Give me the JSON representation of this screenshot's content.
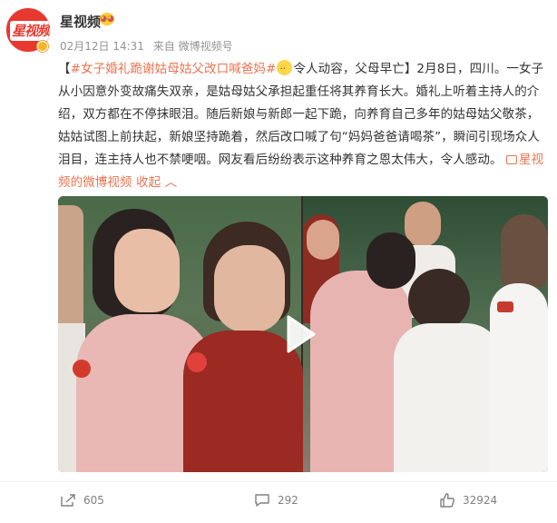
{
  "header": {
    "avatar_text": "星视频",
    "username": "星视频",
    "date": "02月12日 14:31",
    "source": "来自 微博视频号"
  },
  "post": {
    "tag": "#女子婚礼跪谢姑母姑父改口喊爸妈#",
    "text_1": "令人动容，父母早亡】2月8日，四川。一女子从小因意外变故痛失双亲，是姑母姑父承担起重任将其养育长大。婚礼上听着主持人的介绍，双方都在不停抹眼泪。随后新娘与新郎一起下跪，向养育自己多年的姑母姑父敬茶，姑姑试图上前扶起，新娘坚持跪着，然后改口喊了句“妈妈爸爸请喝茶”，瞬间引现场众人泪目，连主持人也不禁哽咽。网友看后纷纷表示这种养育之恩太伟大，令人感动。",
    "open_bracket": "【",
    "video_link": "星视频的微博视频",
    "collapse": "收起"
  },
  "actions": {
    "share_count": "605",
    "comment_count": "292",
    "like_count": "32924"
  },
  "colors": {
    "accent": "#eb7350",
    "meta": "#939393",
    "brand_red": "#e8382f"
  }
}
